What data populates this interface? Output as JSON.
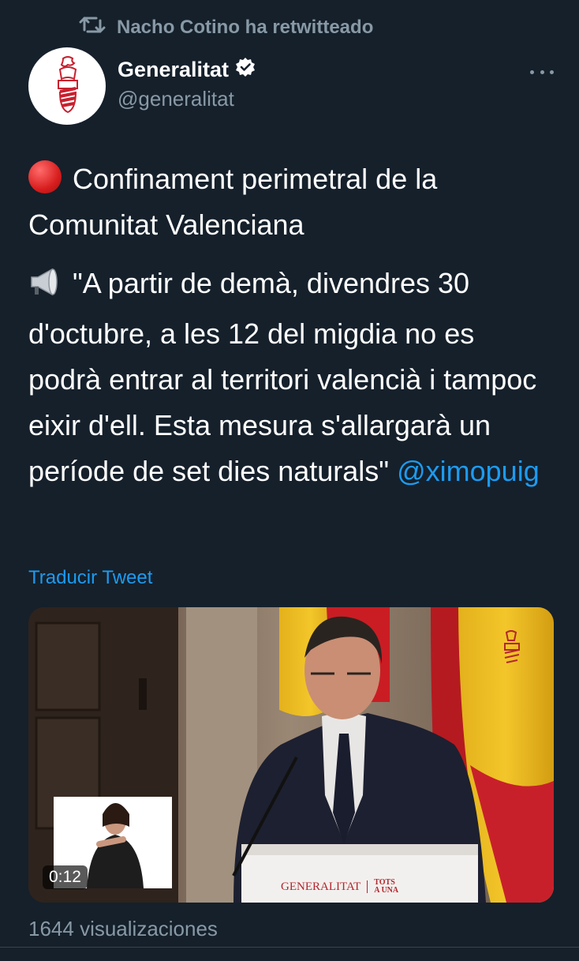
{
  "retweet": {
    "icon": "retweet-icon",
    "text": "Nacho Cotino ha retwitteado"
  },
  "author": {
    "name": "Generalitat",
    "handle": "@generalitat",
    "verified": true,
    "avatar_icon": "generalitat-logo-icon"
  },
  "menu_icon": "more-options-icon",
  "tweet": {
    "p1_emoji": "red-circle-icon",
    "p1_text": "Confinament perimetral de la Comunitat Valenciana",
    "p2_emoji": "loudspeaker-icon",
    "p2_text": "\"A partir de demà, divendres 30 d'octubre, a les 12 del migdia no es podrà entrar al territori valencià i tampoc eixir d'ell. Esta mesura s'allargarà un període de set dies naturals\"",
    "mention": "@ximopuig"
  },
  "translate_label": "Traducir Tweet",
  "media": {
    "type": "video",
    "duration": "0:12",
    "podium_brand": "GENERALITAT",
    "podium_slogan": "TOTS A UNA"
  },
  "views": "1644 visualizaciones",
  "colors": {
    "background": "#15202b",
    "secondary_text": "#8899a6",
    "link": "#1d9bf0"
  }
}
